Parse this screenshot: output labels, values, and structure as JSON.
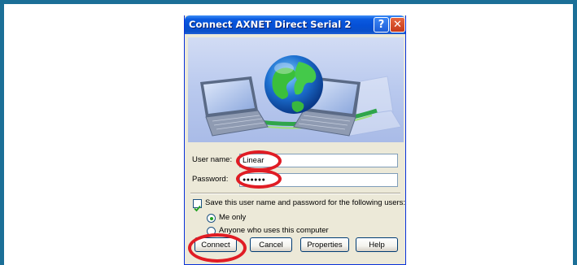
{
  "dialog": {
    "title": "Connect AXNET Direct Serial 2",
    "help_glyph": "?",
    "close_glyph": "✕"
  },
  "form": {
    "username_label": "User name:",
    "username_value": "Linear",
    "password_label": "Password:",
    "password_value": "●●●●●●",
    "save_checkbox_label": "Save this user name and password for the following users:",
    "save_checked": true,
    "radio_me_only_label": "Me only",
    "radio_anyone_label": "Anyone who uses this computer",
    "selected_radio": "Me only"
  },
  "buttons": {
    "connect": "Connect",
    "cancel": "Cancel",
    "properties": "Properties",
    "help": "Help"
  },
  "colors": {
    "frame": "#1b6f97",
    "titlebar": "#0550d6",
    "highlight_ring": "#e01c24",
    "dialog_face": "#ece9d8"
  },
  "icons": {
    "banner": "network-globe-laptops-illustration",
    "help": "help-icon",
    "close": "close-icon"
  }
}
